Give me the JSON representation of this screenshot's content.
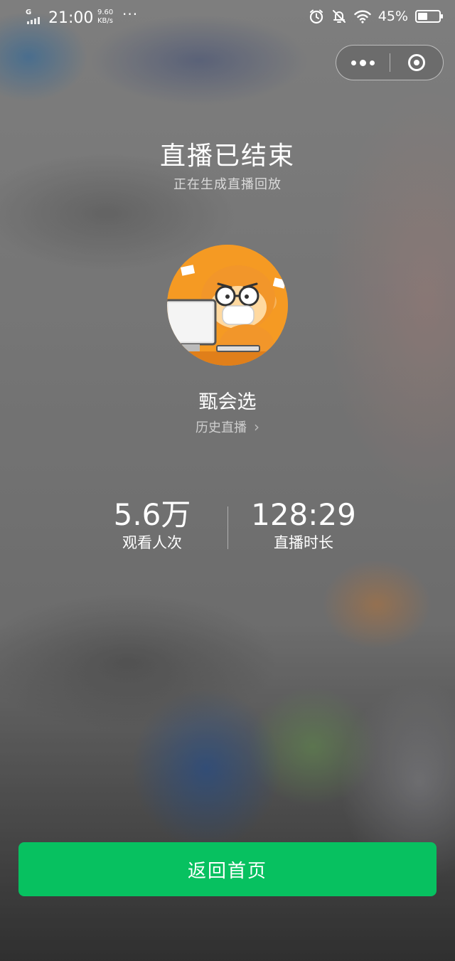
{
  "status_bar": {
    "network": "G",
    "time": "21:00",
    "speed_value": "9.60",
    "speed_unit": "KB/s",
    "more": "···",
    "battery_percent": "45%",
    "battery_level": 0.45,
    "icons": [
      "alarm-icon",
      "mute-bell-icon",
      "wifi-icon",
      "battery-icon"
    ]
  },
  "capsule": {
    "more_icon": "more-dots-icon",
    "close_icon": "target-close-icon"
  },
  "main": {
    "title": "直播已结束",
    "subtitle": "正在生成直播回放",
    "avatar_icon": "monkey-avatar",
    "streamer_name": "甄会选",
    "history_label": "历史直播",
    "stats": [
      {
        "value": "5.6万",
        "label": "观看人次"
      },
      {
        "value": "128:29",
        "label": "直播时长"
      }
    ]
  },
  "footer": {
    "home_button": "返回首页"
  },
  "colors": {
    "accent": "#07c160",
    "avatar_bg": "#f59a23"
  }
}
